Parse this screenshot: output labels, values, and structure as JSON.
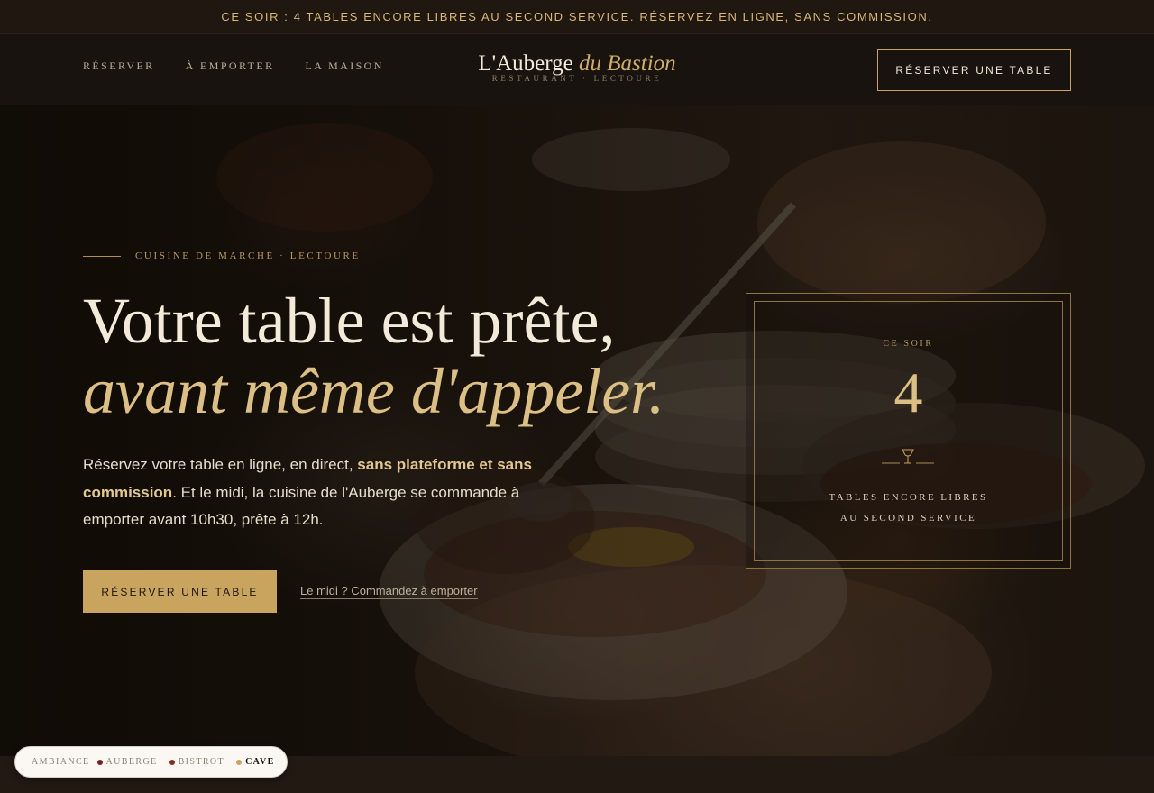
{
  "announcement": "CE SOIR : 4 TABLES ENCORE LIBRES AU SECOND SERVICE. RÉSERVEZ EN LIGNE, SANS COMMISSION.",
  "nav": {
    "items": [
      {
        "label": "RÉSERVER"
      },
      {
        "label": "À EMPORTER"
      },
      {
        "label": "LA MAISON"
      }
    ],
    "cta_label": "RÉSERVER UNE TABLE"
  },
  "logo": {
    "name_plain": "L'Auberge",
    "name_italic": "du Bastion",
    "tagline": "RESTAURANT · LECTOURE"
  },
  "hero": {
    "eyebrow": "CUISINE DE MARCHÉ · LECTOURE",
    "headline_line1": "Votre table est prête,",
    "headline_line2": "avant même d'appeler.",
    "lead_part1": "Réservez votre table en ligne, en direct, ",
    "lead_highlight": "sans plateforme et sans commission",
    "lead_part2": ". Et le midi, la cuisine de l'Auberge se commande à emporter avant 10h30, prête à 12h.",
    "primary_cta": "RÉSERVER UNE TABLE",
    "secondary_link": "Le midi ? Commandez à emporter"
  },
  "availability_card": {
    "label": "CE SOIR",
    "count": "4",
    "caption_line1": "TABLES ENCORE LIBRES",
    "caption_line2": "AU SECOND SERVICE",
    "icon": "wine-glass-icon"
  },
  "ambiance_switcher": {
    "label": "AMBIANCE",
    "options": [
      {
        "label": "AUBERGE",
        "color": "#7a1f24",
        "active": false
      },
      {
        "label": "BISTROT",
        "color": "#8a2a24",
        "active": false
      },
      {
        "label": "CAVE",
        "color": "#c9a45e",
        "active": true
      }
    ]
  },
  "colors": {
    "accent_gold": "#c9a45e",
    "background": "#18130e",
    "headline_cream": "#f3ead9"
  }
}
